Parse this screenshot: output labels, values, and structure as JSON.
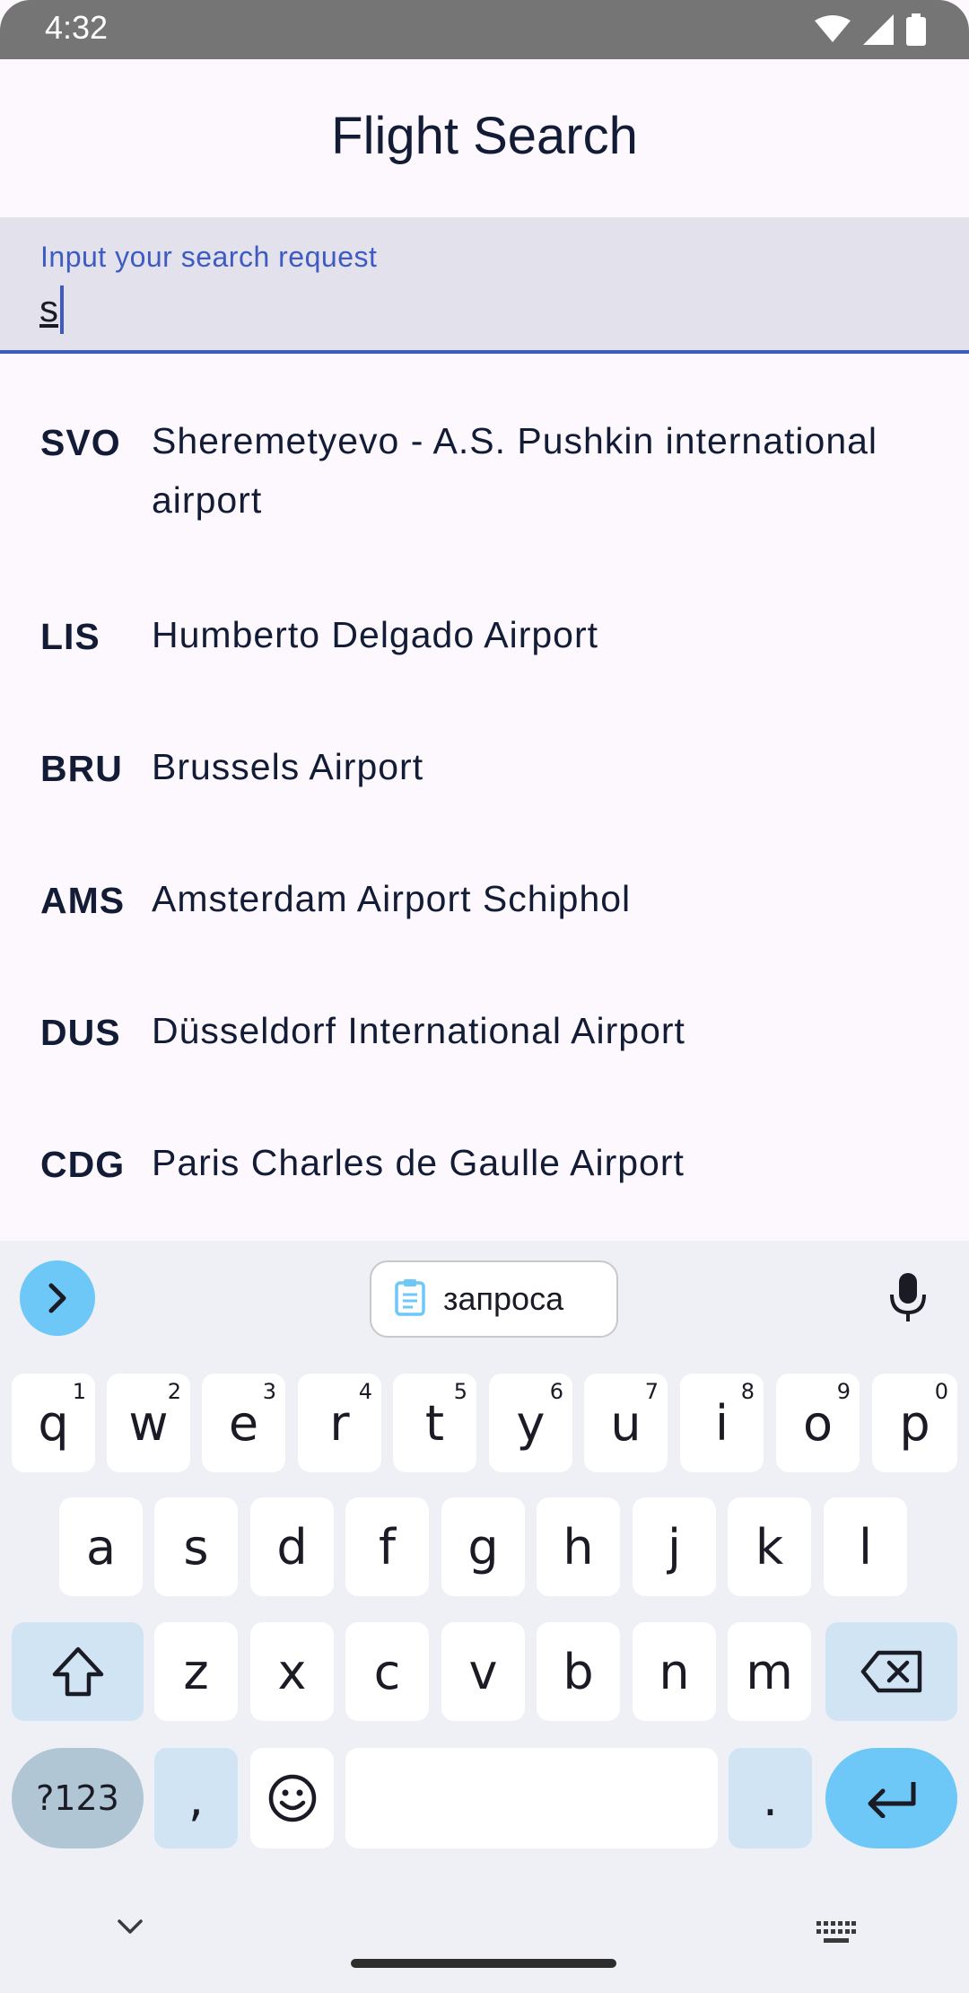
{
  "status_bar": {
    "time": "4:32"
  },
  "app_bar": {
    "title": "Flight Search"
  },
  "search": {
    "label": "Input your search request",
    "value": "s"
  },
  "results": [
    {
      "code": "SVO",
      "name": "Sheremetyevo - A.S. Pushkin international airport"
    },
    {
      "code": "LIS",
      "name": "Humberto Delgado Airport"
    },
    {
      "code": "BRU",
      "name": "Brussels Airport"
    },
    {
      "code": "AMS",
      "name": "Amsterdam Airport Schiphol"
    },
    {
      "code": "DUS",
      "name": "Düsseldorf International Airport"
    },
    {
      "code": "CDG",
      "name": "Paris Charles de Gaulle Airport"
    }
  ],
  "keyboard": {
    "clipboard_suggestion": "запроса",
    "row1": [
      {
        "key": "q",
        "hint": "1"
      },
      {
        "key": "w",
        "hint": "2"
      },
      {
        "key": "e",
        "hint": "3"
      },
      {
        "key": "r",
        "hint": "4"
      },
      {
        "key": "t",
        "hint": "5"
      },
      {
        "key": "y",
        "hint": "6"
      },
      {
        "key": "u",
        "hint": "7"
      },
      {
        "key": "i",
        "hint": "8"
      },
      {
        "key": "o",
        "hint": "9"
      },
      {
        "key": "p",
        "hint": "0"
      }
    ],
    "row2": [
      "a",
      "s",
      "d",
      "f",
      "g",
      "h",
      "j",
      "k",
      "l"
    ],
    "row3": [
      "z",
      "x",
      "c",
      "v",
      "b",
      "n",
      "m"
    ],
    "symbols_label": "?123",
    "comma": ",",
    "period": "."
  },
  "colors": {
    "accent": "#3d5bc0",
    "keyboard_accent": "#6dc8f8",
    "background": "#fdf8fd"
  }
}
